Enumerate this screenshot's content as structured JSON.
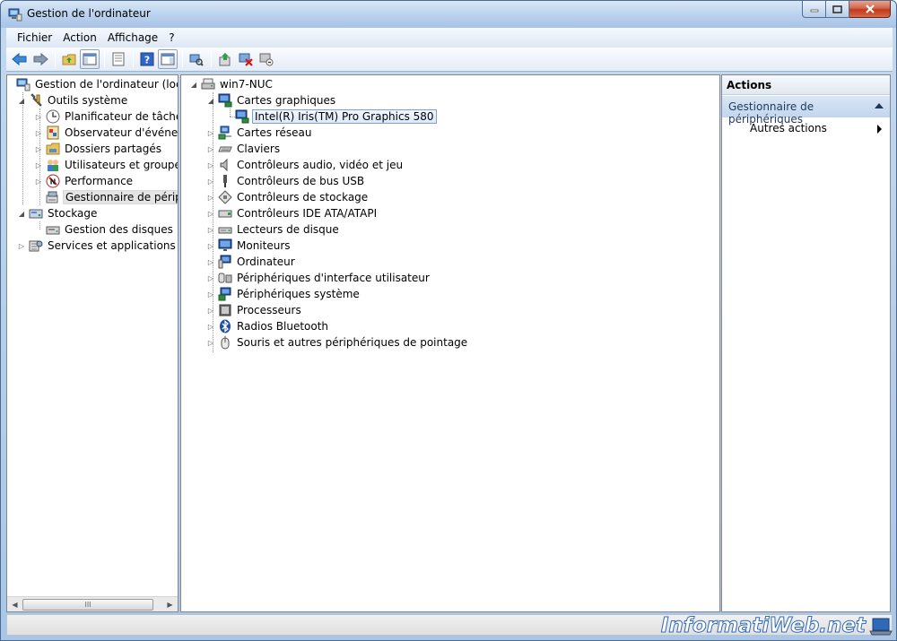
{
  "window": {
    "title": "Gestion de l'ordinateur"
  },
  "menu": [
    {
      "label": "Fichier"
    },
    {
      "label": "Action"
    },
    {
      "label": "Affichage"
    },
    {
      "label": "?"
    }
  ],
  "toolbar": {
    "icons": [
      "back-arrow-icon",
      "forward-arrow-icon",
      "up-folder-icon",
      "show-hide-tree-icon",
      "properties-icon",
      "help-icon",
      "show-hide-action-pane-icon",
      "scan-hardware-icon",
      "update-driver-icon",
      "uninstall-device-icon",
      "disable-device-icon"
    ]
  },
  "left_tree": [
    {
      "label": "Gestion de l'ordinateur (local)",
      "icon": "computer-management-icon"
    },
    {
      "label": "Outils système",
      "icon": "tools-icon"
    },
    {
      "label": "Planificateur de tâches",
      "icon": "clock-icon"
    },
    {
      "label": "Observateur d'événements",
      "icon": "event-viewer-icon"
    },
    {
      "label": "Dossiers partagés",
      "icon": "shared-folder-icon"
    },
    {
      "label": "Utilisateurs et groupes locaux",
      "icon": "users-icon"
    },
    {
      "label": "Performance",
      "icon": "performance-icon"
    },
    {
      "label": "Gestionnaire de périphériques",
      "icon": "device-manager-icon"
    },
    {
      "label": "Stockage",
      "icon": "storage-icon"
    },
    {
      "label": "Gestion des disques",
      "icon": "disk-icon"
    },
    {
      "label": "Services et applications",
      "icon": "services-icon"
    }
  ],
  "device_tree": {
    "root": "win7-NUC",
    "graphics_category": "Cartes graphiques",
    "graphics_device": "Intel(R) Iris(TM) Pro Graphics 580",
    "categories": [
      "Cartes réseau",
      "Claviers",
      "Contrôleurs audio, vidéo et jeu",
      "Contrôleurs de bus USB",
      "Contrôleurs de stockage",
      "Contrôleurs IDE ATA/ATAPI",
      "Lecteurs de disque",
      "Moniteurs",
      "Ordinateur",
      "Périphériques d'interface utilisateur",
      "Périphériques système",
      "Processeurs",
      "Radios Bluetooth",
      "Souris et autres périphériques de pointage"
    ]
  },
  "actions": {
    "header": "Actions",
    "section": "Gestionnaire de périphériques",
    "item": "Autres actions"
  },
  "scrollbar": {
    "thumb_glyph": "III"
  },
  "watermark": "InformatiWeb.net"
}
